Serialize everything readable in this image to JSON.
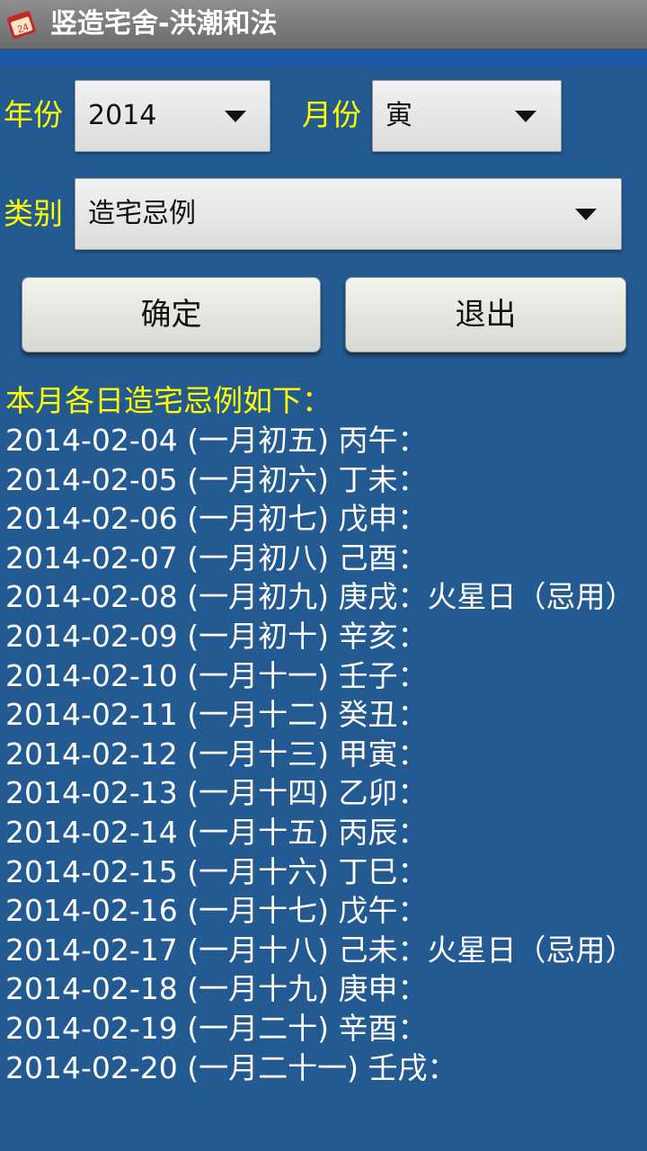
{
  "app": {
    "title": "竖造宅舍-洪潮和法",
    "icon": "calendar-app-icon"
  },
  "form": {
    "year_label": "年份",
    "year_value": "2014",
    "month_label": "月份",
    "month_value": "寅",
    "category_label": "类别",
    "category_value": "造宅忌例"
  },
  "buttons": {
    "confirm": "确定",
    "exit": "退出"
  },
  "result": {
    "heading": "本月各日造宅忌例如下：",
    "rows": [
      "2014-02-04 (一月初五) 丙午：",
      "2014-02-05 (一月初六) 丁未：",
      "2014-02-06 (一月初七) 戊申：",
      "2014-02-07 (一月初八) 己酉：",
      "2014-02-08 (一月初九) 庚戌：火星日（忌用）",
      "2014-02-09 (一月初十) 辛亥：",
      "2014-02-10 (一月十一) 壬子：",
      "2014-02-11 (一月十二) 癸丑：",
      "2014-02-12 (一月十三) 甲寅：",
      "2014-02-13 (一月十四) 乙卯：",
      "2014-02-14 (一月十五) 丙辰：",
      "2014-02-15 (一月十六) 丁巳：",
      "2014-02-16 (一月十七) 戊午：",
      "2014-02-17 (一月十八) 己未：火星日（忌用）",
      "2014-02-18 (一月十九) 庚申：",
      "2014-02-19 (一月二十) 辛酉：",
      "2014-02-20 (一月二十一) 壬戌："
    ]
  },
  "colors": {
    "background": "#235a92",
    "label_yellow": "#ffff00",
    "titlebar": "#7a7a7a"
  }
}
